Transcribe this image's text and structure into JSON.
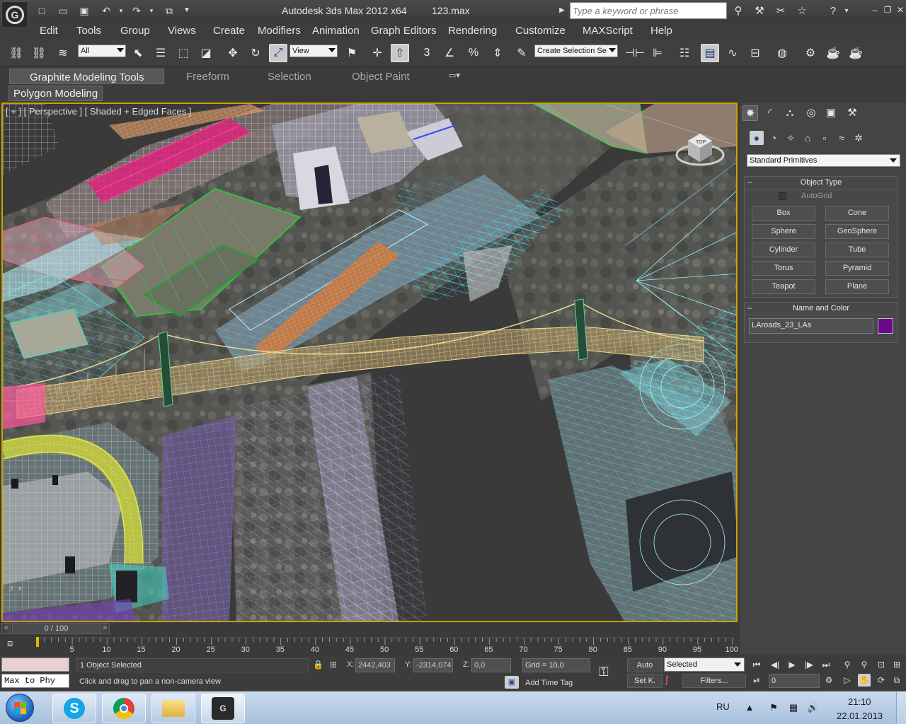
{
  "window": {
    "title": "Autodesk 3ds Max  2012 x64",
    "file": "123.max",
    "search_placeholder": "Type a keyword or phrase"
  },
  "menu": [
    "Edit",
    "Tools",
    "Group",
    "Views",
    "Create",
    "Modifiers",
    "Animation",
    "Graph Editors",
    "Rendering",
    "Customize",
    "MAXScript",
    "Help"
  ],
  "toolbar": {
    "selection_filter": "All",
    "ref_coord": "View",
    "named_selection": "Create Selection Se",
    "snap_3": "3",
    "snap_pct": "%"
  },
  "ribbon": {
    "tabs": [
      "Graphite Modeling Tools",
      "Freeform",
      "Selection",
      "Object Paint"
    ],
    "panel": "Polygon Modeling"
  },
  "viewport": {
    "label": "[ + ] [ Perspective ] [ Shaded + Edged Faces ]",
    "cube_face": "TOP",
    "axis_z": "z",
    "axis_x": "x"
  },
  "command_panel": {
    "category": "Standard Primitives",
    "object_type_title": "Object Type",
    "autogrid_label": "AutoGrid",
    "buttons": [
      "Box",
      "Cone",
      "Sphere",
      "GeoSphere",
      "Cylinder",
      "Tube",
      "Torus",
      "Pyramid",
      "Teapot",
      "Plane"
    ],
    "name_color_title": "Name and Color",
    "object_name": "LAroads_23_LAs",
    "object_color": "#6a0a8a"
  },
  "timeslider": {
    "position": "0 / 100",
    "ticks": [
      "5",
      "10",
      "15",
      "20",
      "25",
      "30",
      "35",
      "40",
      "45",
      "50",
      "55",
      "60",
      "65",
      "70",
      "75",
      "80",
      "85",
      "90",
      "95",
      "100"
    ]
  },
  "status": {
    "maxscript": "Max to Phy",
    "selection": "1 Object Selected",
    "prompt": "Click and drag to pan a non-camera view",
    "x_label": "X:",
    "x_value": "2442,403",
    "y_label": "Y:",
    "y_value": "-2314,074",
    "z_label": "Z:",
    "z_value": "0,0",
    "grid": "Grid = 10,0",
    "add_time_tag": "Add Time Tag",
    "auto_key": "Auto",
    "set_key": "Set K.",
    "key_filter_mode": "Selected",
    "filters": "Filters...",
    "frame": "0"
  },
  "taskbar": {
    "lang": "RU",
    "time": "21:10",
    "date": "22.01.2013"
  }
}
